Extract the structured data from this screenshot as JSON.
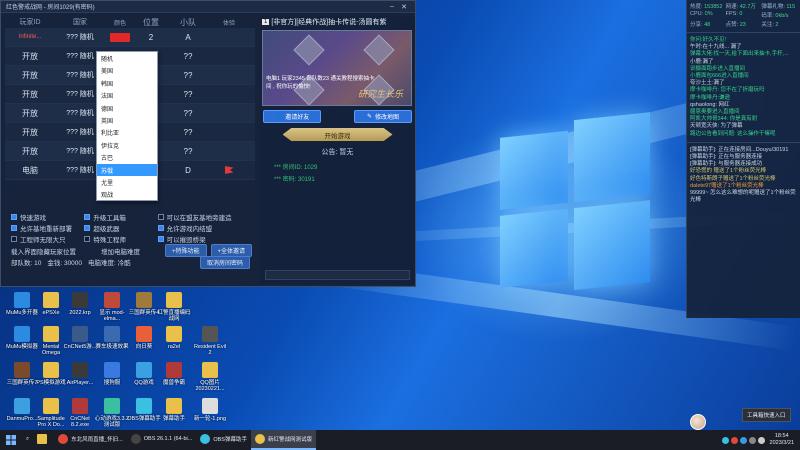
{
  "window": {
    "title": "红色警戒战网 - 房间1029(有密码)",
    "minimize": "–",
    "close": "✕"
  },
  "slots": {
    "headers": [
      "玩家ID",
      "国家",
      "颜色",
      "位置",
      "小队",
      "体验"
    ],
    "rows": [
      {
        "id": "Infinite...",
        "id_style": "self",
        "name": "??? 随机",
        "color": "#e02a2a",
        "pos": "2",
        "team": "A",
        "flag": false
      },
      {
        "id": "开放",
        "id_style": "open",
        "name": "??? 随机",
        "color": "",
        "pos": "??",
        "team": "??",
        "flag": false
      },
      {
        "id": "开放",
        "id_style": "open",
        "name": "??? 随机",
        "color": "",
        "pos": "??",
        "team": "??",
        "flag": false
      },
      {
        "id": "开放",
        "id_style": "open",
        "name": "??? 随机",
        "color": "",
        "pos": "??",
        "team": "??",
        "flag": false
      },
      {
        "id": "开放",
        "id_style": "open",
        "name": "??? 随机",
        "color": "",
        "pos": "??",
        "team": "??",
        "flag": false
      },
      {
        "id": "开放",
        "id_style": "open",
        "name": "??? 随机",
        "color": "",
        "pos": "??",
        "team": "??",
        "flag": false
      },
      {
        "id": "开放",
        "id_style": "open",
        "name": "??? 随机",
        "color": "",
        "pos": "??",
        "team": "??",
        "flag": false
      },
      {
        "id": "电脑",
        "id_style": "open",
        "name": "??? 随机",
        "color": "",
        "pos": "1",
        "team": "D",
        "flag": true
      }
    ]
  },
  "country_dropdown": {
    "options": [
      "随机",
      "美国",
      "韩国",
      "法国",
      "德国",
      "英国",
      "利比亚",
      "伊拉克",
      "古巴",
      "苏俄",
      "尤里",
      "观战"
    ],
    "selected_index": 9
  },
  "options": {
    "row1": [
      "快速游戏",
      "升级工具箱",
      "可以在盟友基地旁建造"
    ],
    "row2": [
      "允许基地重新部署",
      "超级武器",
      "允许游戏内结盟"
    ],
    "row3": [
      "工程师无限大只",
      "特殊工程师",
      "可以摧毁桥梁"
    ],
    "row4_label": "载入界面隐藏玩家位置",
    "row4_label2": "增加电脑难度",
    "ai_button": "+特殊功能",
    "all_button": "+全体邀请",
    "checked": [
      true,
      true,
      false,
      true,
      true,
      true,
      false,
      false,
      true
    ]
  },
  "stats": {
    "units": "部队数: 10",
    "money": "金钱: 30000",
    "ai": "电脑难度: 冷酷",
    "cancel_button": "取消房间密码"
  },
  "map": {
    "index": "1",
    "title": "[非官方][经典作战]抽卡传说-汤圆有紫",
    "info_line1": "电脑1  玩家2345  部队数23  通关教程搜索抽卡",
    "info_line2": "间 , 祝你玩的愉快!",
    "gold_text": "研究生长乐",
    "invite_button": "邀请好友",
    "modify_button": "修改地图",
    "start_button": "开始游戏",
    "announce": "公告: 暂无",
    "room_id": "*** 房间ID: 1029",
    "room_pwd": "*** 密码: 30191"
  },
  "perf": [
    {
      "k": "热度:",
      "v": "153852"
    },
    {
      "k": "网速:",
      "v": "42.7万"
    },
    {
      "k": "弹幕礼物:",
      "v": "115"
    },
    {
      "k": "CPU:",
      "v": "0%"
    },
    {
      "k": "FPS:",
      "v": "0"
    },
    {
      "k": "码率:",
      "v": "0kb/s"
    },
    {
      "k": "分享:",
      "v": "48"
    },
    {
      "k": "点赞:",
      "v": "23"
    },
    {
      "k": "关注:",
      "v": "2"
    }
  ],
  "chat": [
    {
      "c": "g",
      "t": "你问:好久不见!"
    },
    {
      "c": "w",
      "t": "午时:在十九线... 漏了"
    },
    {
      "c": "g",
      "t": "弹幕大佬:找一天,给下面出来抽卡,手杆,..."
    },
    {
      "c": "w",
      "t": "小鹿:漏了"
    },
    {
      "c": "g",
      "t": "训摄面跑步进入直播间"
    },
    {
      "c": "g",
      "t": "小鹿面包666进入直播间"
    },
    {
      "c": "w",
      "t": "夸沙土土:漏了"
    },
    {
      "c": "g",
      "t": "摩卡咖啡丹: 您不在了折磨玩吗"
    },
    {
      "c": "g",
      "t": "摩卡咖啡丹:谦逊"
    },
    {
      "c": "w",
      "t": "qshaolong: 网红"
    },
    {
      "c": "g",
      "t": "疆恩奥要进入直播间"
    },
    {
      "c": "g",
      "t": "阿凯大帅哥344: 你是真有耐"
    },
    {
      "c": "w",
      "t": "天顿宽天侠: 为了弹幕"
    },
    {
      "c": "g",
      "t": "路边公告看到问题: 这么操作干嘛呢"
    }
  ],
  "chat2": [
    {
      "c": "w",
      "t": "[弹幕助手]: 正在连接房间...Douyu/30191"
    },
    {
      "c": "w",
      "t": "[弹幕助手]: 正在与服务器连接"
    },
    {
      "c": "w",
      "t": "[弹幕助手]: 与服务器连接成功"
    },
    {
      "c": "y",
      "t": "好恐慌的 赠送了1个粉丝荧光棒"
    },
    {
      "c": "y",
      "t": "好色特斯朗子赠送了1个粉丝荧光棒"
    },
    {
      "c": "o",
      "t": "dalete97赠送了1个粉丝荧光棒"
    },
    {
      "c": "w",
      "t": "99999~ 怎么这么难想的呢赠送了1个粉丝荧光棒"
    }
  ],
  "desktop_icons": [
    {
      "label": "MuMu多开器",
      "color": "#2a8be0"
    },
    {
      "label": "ePSXe",
      "color": "#e8c04a"
    },
    {
      "label": "2022.krp",
      "color": "#3a3a3a"
    },
    {
      "label": "显示\nmod-elma...",
      "color": "#c04a3a"
    },
    {
      "label": "三国群英传4",
      "color": "#a07a3a"
    },
    {
      "label": "红警直播编码战网",
      "color": "#e8c04a"
    },
    {
      "label": "MuMu模拟器",
      "color": "#2a8be0"
    },
    {
      "label": "Mental Omega",
      "color": "#e8c04a"
    },
    {
      "label": "CnCNet5游...",
      "color": "#3a5a8a"
    },
    {
      "label": "赛车极速效果",
      "color": "#3a6ab0"
    },
    {
      "label": "向日葵",
      "color": "#e8603a"
    },
    {
      "label": "ra2el",
      "color": "#e8c04a"
    },
    {
      "label": "Resident Evil 2",
      "color": "#555"
    },
    {
      "label": "三国群英传7",
      "color": "#7a4a2a"
    },
    {
      "label": "PS模拟游戏",
      "color": "#e8c04a"
    },
    {
      "label": "AirPlayer...",
      "color": "#3a3a3a"
    },
    {
      "label": "搜狗服",
      "color": "#3a7ae0"
    },
    {
      "label": "QQ游戏",
      "color": "#3aa0e0"
    },
    {
      "label": "魔兽争霸",
      "color": "#b03a3a"
    },
    {
      "label": "QQ图片20230221...",
      "color": "#e8c04a"
    },
    {
      "label": "DanmuPro...",
      "color": "#3aa0e0"
    },
    {
      "label": "Samplitude Pro X Do...",
      "color": "#e8c04a"
    },
    {
      "label": "CnCNet 8.2.exe",
      "color": "#b03a3a"
    },
    {
      "label": "心动游戏3.3.2测试版",
      "color": "#3ac0a0"
    },
    {
      "label": "OBS弹幕助手",
      "color": "#3ac0e0"
    },
    {
      "label": "弹幕助手",
      "color": "#e8c04a"
    },
    {
      "label": "新一轮-1.png",
      "color": "#ddd"
    }
  ],
  "taskbar": {
    "items": [
      {
        "label": "东北风雨直播_怀旧...",
        "color": "#e04a3a",
        "active": false
      },
      {
        "label": "OBS 26.1.1 (64-bi...",
        "color": "#444",
        "active": false
      },
      {
        "label": "OBS弹幕助手",
        "color": "#3ac0e0",
        "active": false
      },
      {
        "label": "新红警战网测试版",
        "color": "#e8c04a",
        "active": true
      }
    ],
    "time": "18:54",
    "date": "2023/3/21",
    "toast": "工具箱快速入口"
  }
}
